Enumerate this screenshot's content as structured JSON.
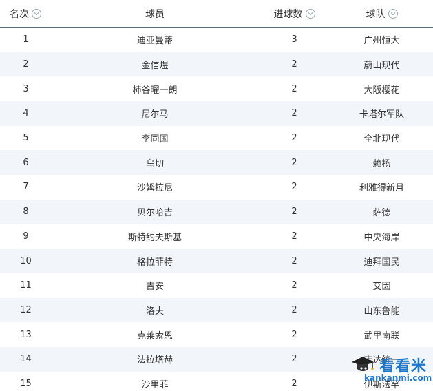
{
  "header": {
    "rank": "名次",
    "player": "球员",
    "goals": "进球数",
    "team": "球队"
  },
  "rows": [
    {
      "rank": "1",
      "player": "迪亚曼蒂",
      "goals": "3",
      "team": "广州恒大"
    },
    {
      "rank": "2",
      "player": "金信煜",
      "goals": "2",
      "team": "蔚山现代"
    },
    {
      "rank": "3",
      "player": "柿谷曜一朗",
      "goals": "2",
      "team": "大阪樱花"
    },
    {
      "rank": "4",
      "player": "尼尔马",
      "goals": "2",
      "team": "卡塔尔军队"
    },
    {
      "rank": "5",
      "player": "李同国",
      "goals": "2",
      "team": "全北现代"
    },
    {
      "rank": "6",
      "player": "乌切",
      "goals": "2",
      "team": "赖扬"
    },
    {
      "rank": "7",
      "player": "沙姆拉尼",
      "goals": "2",
      "team": "利雅得新月"
    },
    {
      "rank": "8",
      "player": "贝尔哈吉",
      "goals": "2",
      "team": "萨德"
    },
    {
      "rank": "9",
      "player": "斯特约夫斯基",
      "goals": "2",
      "team": "中央海岸"
    },
    {
      "rank": "10",
      "player": "格拉菲特",
      "goals": "2",
      "team": "迪拜国民"
    },
    {
      "rank": "11",
      "player": "吉安",
      "goals": "2",
      "team": "艾因"
    },
    {
      "rank": "12",
      "player": "洛夫",
      "goals": "2",
      "team": "山东鲁能"
    },
    {
      "rank": "13",
      "player": "克莱索恩",
      "goals": "2",
      "team": "武里南联"
    },
    {
      "rank": "14",
      "player": "法拉塔赫",
      "goals": "2",
      "team": "吉达统一"
    },
    {
      "rank": "15",
      "player": "沙里菲",
      "goals": "2",
      "team": "伊斯法罕"
    }
  ],
  "watermark": {
    "title": "看看米",
    "url": "kankanmi.com"
  },
  "colors": {
    "header_border": "#5c6b7a",
    "row_alt": "#f2f5f9",
    "watermark": "#1e77c9"
  }
}
